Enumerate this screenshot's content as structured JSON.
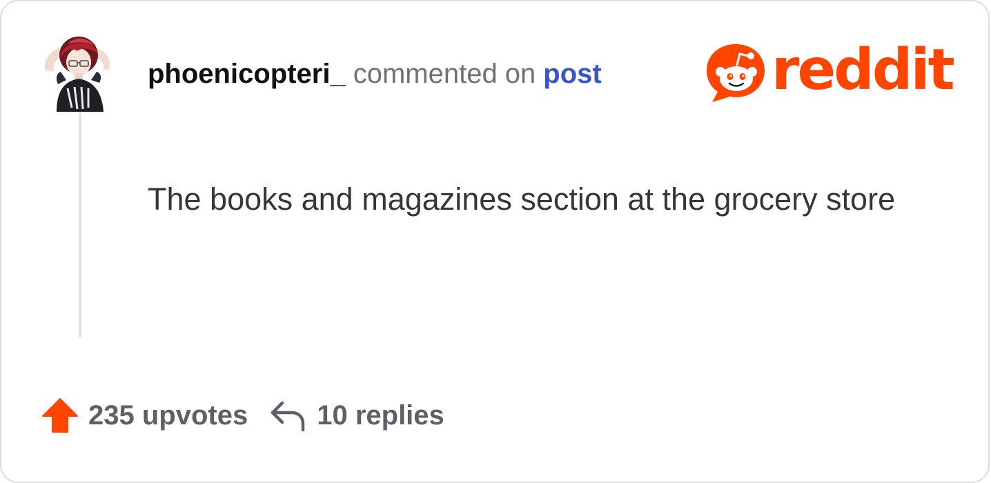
{
  "comment": {
    "username": "phoenicopteri_",
    "action_text": "commented on",
    "target_link": "post",
    "body": "The books and magazines section at the grocery store"
  },
  "brand": {
    "wordmark": "reddit",
    "color": "#ff4500"
  },
  "stats": {
    "upvotes_label": "235 upvotes",
    "replies_label": "10 replies"
  },
  "icons": {
    "avatar": "user-avatar-anime-character",
    "logo": "reddit-snoo-icon",
    "upvote": "upvote-arrow-icon",
    "reply": "reply-arrow-icon"
  },
  "colors": {
    "username": "#111111",
    "action": "#6c727a",
    "link": "#3657c9",
    "body": "#33373d",
    "footer": "#5c6168",
    "upvote": "#ff4500"
  }
}
